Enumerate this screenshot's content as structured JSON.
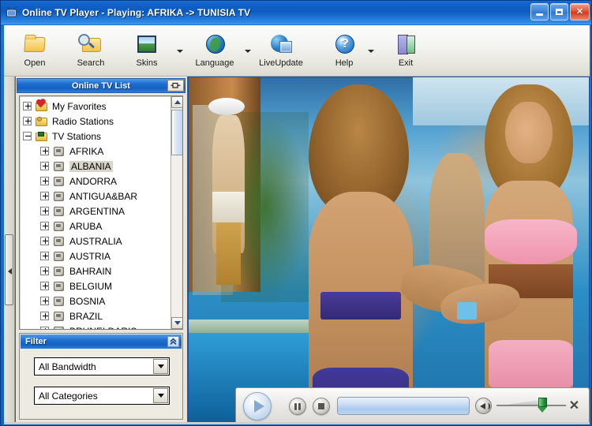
{
  "window": {
    "title": "Online TV Player - Playing: AFRIKA -> TUNISIA TV",
    "app_icon": "tv-icon",
    "controls": {
      "minimize": "minimize-icon",
      "maximize": "maximize-icon",
      "close": "✕"
    }
  },
  "toolbar": {
    "buttons": [
      {
        "label": "Open",
        "icon": "open-folder-icon",
        "has_dropdown": false
      },
      {
        "label": "Search",
        "icon": "search-folder-icon",
        "has_dropdown": false
      },
      {
        "label": "Skins",
        "icon": "skins-picture-icon",
        "has_dropdown": true
      },
      {
        "label": "Language",
        "icon": "globe-icon",
        "has_dropdown": true
      },
      {
        "label": "LiveUpdate",
        "icon": "live-update-icon",
        "has_dropdown": false
      },
      {
        "label": "Help",
        "icon": "help-question-icon",
        "has_dropdown": true
      },
      {
        "label": "Exit",
        "icon": "exit-door-icon",
        "has_dropdown": false
      }
    ]
  },
  "sidebar": {
    "header": {
      "title": "Online TV List",
      "pin_icon": "pin-icon"
    },
    "tree": [
      {
        "label": "My Favorites",
        "level": 1,
        "state": "collapsed",
        "icon": "favorites-folder-icon",
        "selected": false
      },
      {
        "label": "Radio Stations",
        "level": 1,
        "state": "collapsed",
        "icon": "radio-folder-icon",
        "selected": false
      },
      {
        "label": "TV Stations",
        "level": 1,
        "state": "expanded",
        "icon": "tv-folder-icon",
        "selected": false
      },
      {
        "label": "AFRIKA",
        "level": 2,
        "state": "collapsed",
        "icon": "channel-icon",
        "selected": false
      },
      {
        "label": "ALBANIA",
        "level": 2,
        "state": "collapsed",
        "icon": "channel-icon",
        "selected": true
      },
      {
        "label": "ANDORRA",
        "level": 2,
        "state": "collapsed",
        "icon": "channel-icon",
        "selected": false
      },
      {
        "label": "ANTIGUA&BAR",
        "level": 2,
        "state": "collapsed",
        "icon": "channel-icon",
        "selected": false
      },
      {
        "label": "ARGENTINA",
        "level": 2,
        "state": "collapsed",
        "icon": "channel-icon",
        "selected": false
      },
      {
        "label": "ARUBA",
        "level": 2,
        "state": "collapsed",
        "icon": "channel-icon",
        "selected": false
      },
      {
        "label": "AUSTRALIA",
        "level": 2,
        "state": "collapsed",
        "icon": "channel-icon",
        "selected": false
      },
      {
        "label": "AUSTRIA",
        "level": 2,
        "state": "collapsed",
        "icon": "channel-icon",
        "selected": false
      },
      {
        "label": "BAHRAIN",
        "level": 2,
        "state": "collapsed",
        "icon": "channel-icon",
        "selected": false
      },
      {
        "label": "BELGIUM",
        "level": 2,
        "state": "collapsed",
        "icon": "channel-icon",
        "selected": false
      },
      {
        "label": "BOSNIA",
        "level": 2,
        "state": "collapsed",
        "icon": "channel-icon",
        "selected": false
      },
      {
        "label": "BRAZIL",
        "level": 2,
        "state": "collapsed",
        "icon": "channel-icon",
        "selected": false
      },
      {
        "label": "BRUNEI DARIS.",
        "level": 2,
        "state": "collapsed",
        "icon": "channel-icon",
        "selected": false
      }
    ],
    "scrollbar": {
      "up_arrow": "▲",
      "down_arrow": "▼"
    }
  },
  "filter": {
    "title": "Filter",
    "collapse_icon": "«",
    "bandwidth": {
      "value": "All Bandwidth"
    },
    "categories": {
      "value": "All Categories"
    }
  },
  "player": {
    "play": "play-icon",
    "pause": "pause-icon",
    "stop": "stop-icon",
    "seek": "seek-slider",
    "volume_icon": "speaker-icon",
    "volume_slider": "volume-slider",
    "close": "✕"
  },
  "video": {
    "description": "beach poolside scene with people"
  },
  "colors": {
    "title_blue": "#0c5abf",
    "panel_header_blue": "#1e6fd0",
    "toolbar_bg": "#f3f3ef",
    "selection": "#d8d6cb",
    "volume_green": "#2f9a45",
    "close_red": "#cf3c21"
  }
}
